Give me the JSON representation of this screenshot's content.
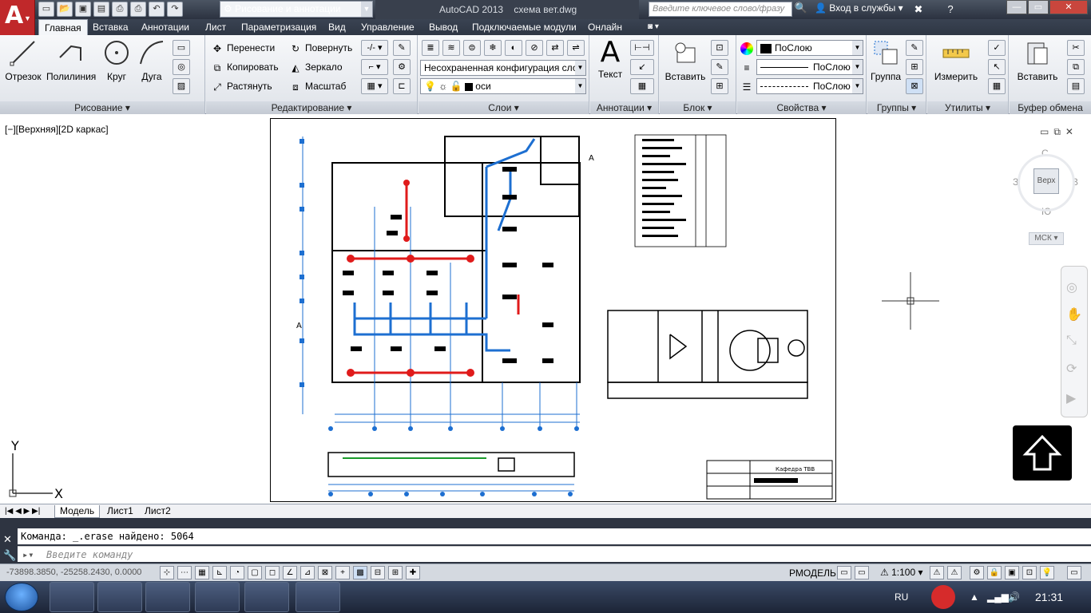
{
  "titlebar": {
    "workspace": "Рисование и аннотации",
    "app_name": "AutoCAD 2013",
    "file_name": "схема вет.dwg",
    "search_placeholder": "Введите ключевое слово/фразу",
    "login": "Вход в службы"
  },
  "tabs": [
    "Главная",
    "Вставка",
    "Аннотации",
    "Лист",
    "Параметризация",
    "Вид",
    "Управление",
    "Вывод",
    "Подключаемые модули",
    "Онлайн"
  ],
  "ribbon": {
    "draw": {
      "title": "Рисование",
      "line": "Отрезок",
      "polyline": "Полилиния",
      "circle": "Круг",
      "arc": "Дуга"
    },
    "modify": {
      "title": "Редактирование",
      "move": "Перенести",
      "rotate": "Повернуть",
      "copy": "Копировать",
      "mirror": "Зеркало",
      "stretch": "Растянуть",
      "scale": "Масштаб"
    },
    "layers": {
      "title": "Слои",
      "state": "Несохраненная конфигурация слое",
      "current": "оси"
    },
    "annotation": {
      "title": "Аннотации",
      "text": "Текст"
    },
    "block": {
      "title": "Блок",
      "insert": "Вставить"
    },
    "properties": {
      "title": "Свойства",
      "color": "ПоСлою",
      "lineweight": "ПоСлою",
      "linetype": "ПоСлою"
    },
    "groups": {
      "title": "Группы",
      "group": "Группа"
    },
    "utilities": {
      "title": "Утилиты",
      "measure": "Измерить"
    },
    "clipboard": {
      "title": "Буфер обмена",
      "paste": "Вставить"
    }
  },
  "viewport": {
    "label": "[−][Верхняя][2D каркас]"
  },
  "viewcube": {
    "north": "С",
    "south": "Ю",
    "west": "З",
    "east": "В",
    "face": "Верх",
    "ucs": "МСК"
  },
  "drawing": {
    "title_block_text": "Кафедра ТВВ",
    "label_a1": "А",
    "label_a2": "А"
  },
  "layout_tabs": [
    "Модель",
    "Лист1",
    "Лист2"
  ],
  "command": {
    "history": "Команда:  _.erase найдено: 5064",
    "placeholder": "Введите команду"
  },
  "status": {
    "coords": "-73898.3850, -25258.2430, 0.0000",
    "model": "РМОДЕЛЬ",
    "scale": "1:100"
  },
  "taskbar": {
    "lang": "RU",
    "time": "21:31"
  },
  "colors": {
    "ribbon_bg": "#e6e9ee",
    "autocad_red": "#c0282a",
    "duct_blue": "#1d6fd1",
    "duct_red": "#e01b1b"
  }
}
